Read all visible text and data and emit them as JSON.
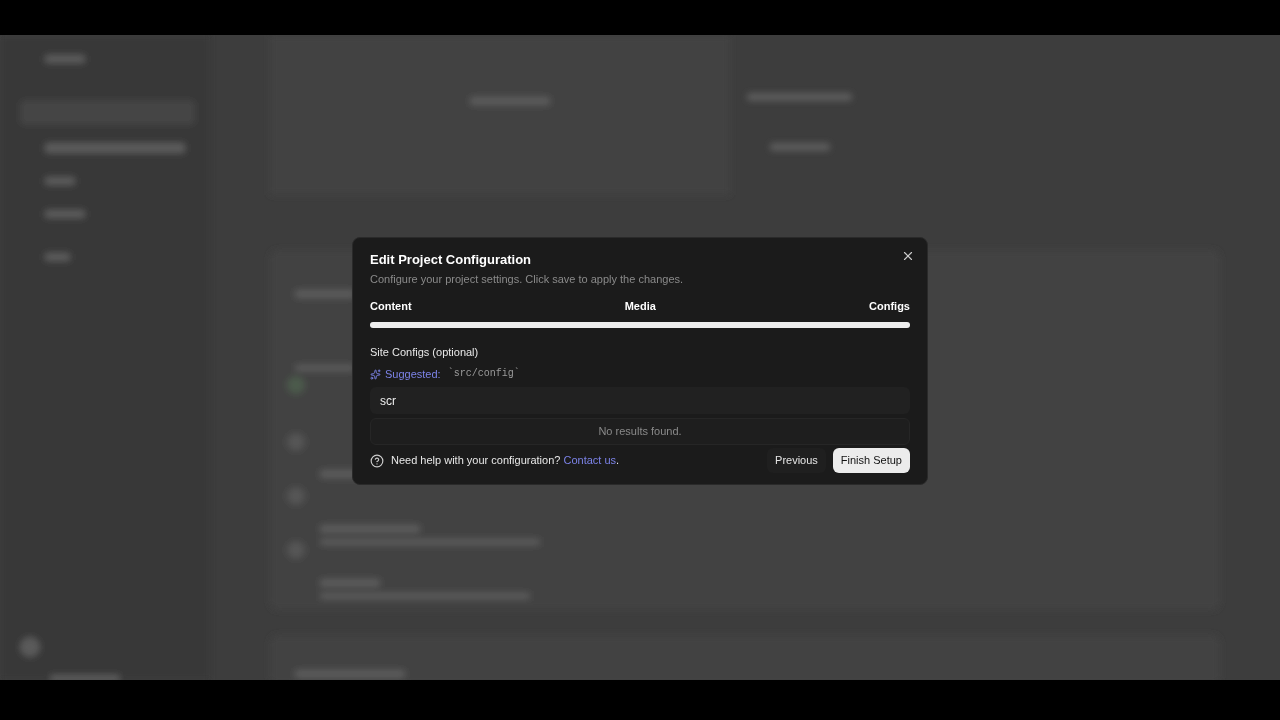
{
  "dialog": {
    "title": "Edit Project Configuration",
    "description": "Configure your project settings. Click save to apply the changes.",
    "steps": [
      {
        "label": "Content"
      },
      {
        "label": "Media"
      },
      {
        "label": "Configs"
      }
    ],
    "progress": {
      "level": 1
    },
    "field": {
      "label": "Site Configs (optional)",
      "suggestion_label": "Suggested:",
      "suggestion_value": "`src/config`",
      "value": "scr",
      "dropdown_message": "No results found."
    },
    "help": {
      "text": "Need help with your configuration?",
      "link": "Contact us",
      "trailing": "."
    },
    "buttons": [
      {
        "label": "Previous",
        "kind": "secondary"
      },
      {
        "label": "Finish Setup",
        "kind": "primary"
      }
    ]
  }
}
